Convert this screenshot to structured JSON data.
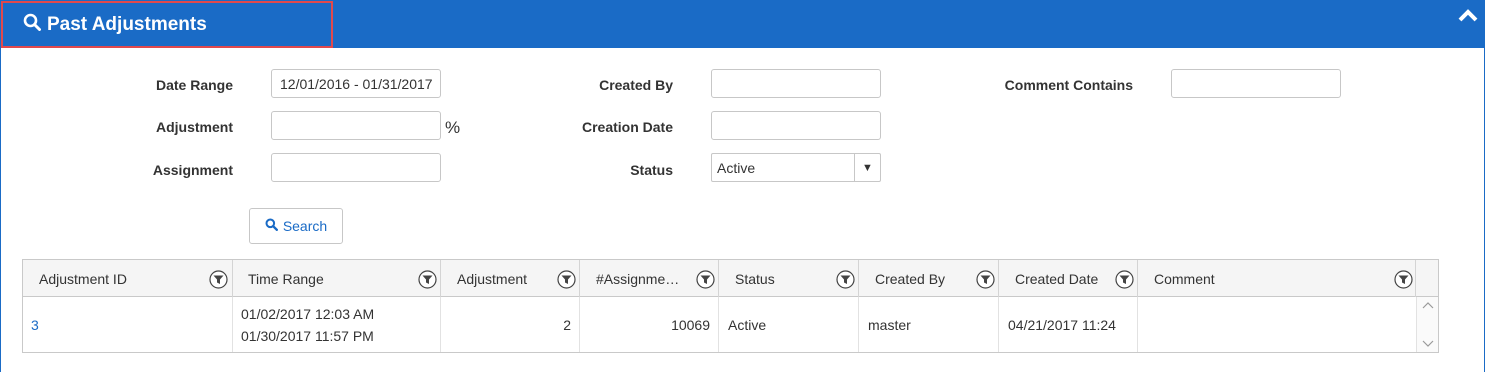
{
  "header": {
    "title": "Past Adjustments",
    "search_icon": "search-icon",
    "collapse_icon": "chevron-up-icon"
  },
  "form": {
    "date_range_label": "Date Range",
    "date_range_value": "12/01/2016 - 01/31/2017",
    "adjustment_label": "Adjustment",
    "adjustment_value": "",
    "adjustment_unit": "%",
    "assignment_label": "Assignment",
    "assignment_value": "",
    "created_by_label": "Created By",
    "created_by_value": "",
    "creation_date_label": "Creation Date",
    "creation_date_value": "",
    "status_label": "Status",
    "status_value": "Active",
    "comment_contains_label": "Comment Contains",
    "comment_contains_value": "",
    "search_label": "Search"
  },
  "grid": {
    "columns": [
      "Adjustment ID",
      "Time Range",
      "Adjustment",
      "#Assignme…",
      "Status",
      "Created By",
      "Created Date",
      "Comment"
    ],
    "rows": [
      {
        "adjustment_id": "3",
        "time_start": "01/02/2017 12:03 AM",
        "time_end": "01/30/2017 11:57 PM",
        "adjustment": "2",
        "assignments": "10069",
        "status": "Active",
        "created_by": "master",
        "created_date": "04/21/2017 11:24",
        "comment": ""
      }
    ]
  },
  "colors": {
    "header_bg": "#1a6bc6",
    "highlight_border": "#e0494d",
    "link": "#1a6bc6"
  }
}
